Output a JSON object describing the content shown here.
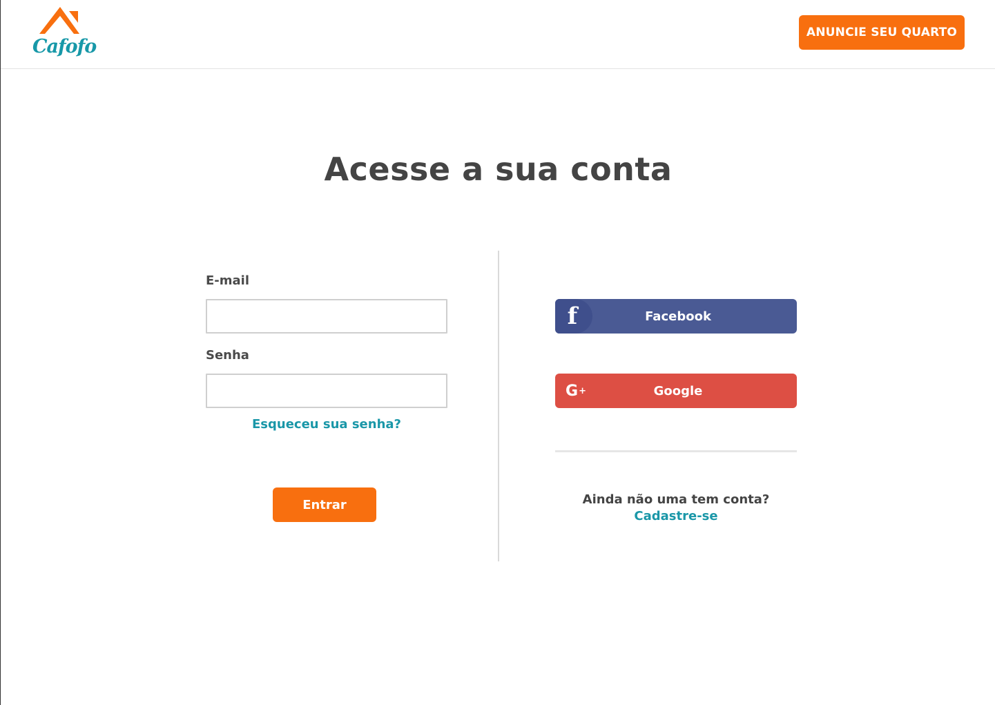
{
  "header": {
    "logo_text": "Cafofo",
    "cta_label": "ANUNCIE SEU QUARTO"
  },
  "main": {
    "title": "Acesse a sua conta",
    "login_form": {
      "email_label": "E-mail",
      "email_value": "",
      "password_label": "Senha",
      "password_value": "",
      "forgot_label": "Esqueceu sua senha?",
      "submit_label": "Entrar"
    },
    "social": {
      "facebook_label": "Facebook",
      "facebook_icon": "facebook-icon",
      "google_label": "Google",
      "google_icon": "google-plus-icon"
    },
    "signup": {
      "prompt": "Ainda não uma tem conta?",
      "link_label": "Cadastre-se"
    }
  },
  "colors": {
    "brand_orange": "#f86f0f",
    "brand_teal": "#1a97a8",
    "facebook_blue": "#4a5a94",
    "google_red": "#dd4f44",
    "text_dark": "#444444"
  }
}
